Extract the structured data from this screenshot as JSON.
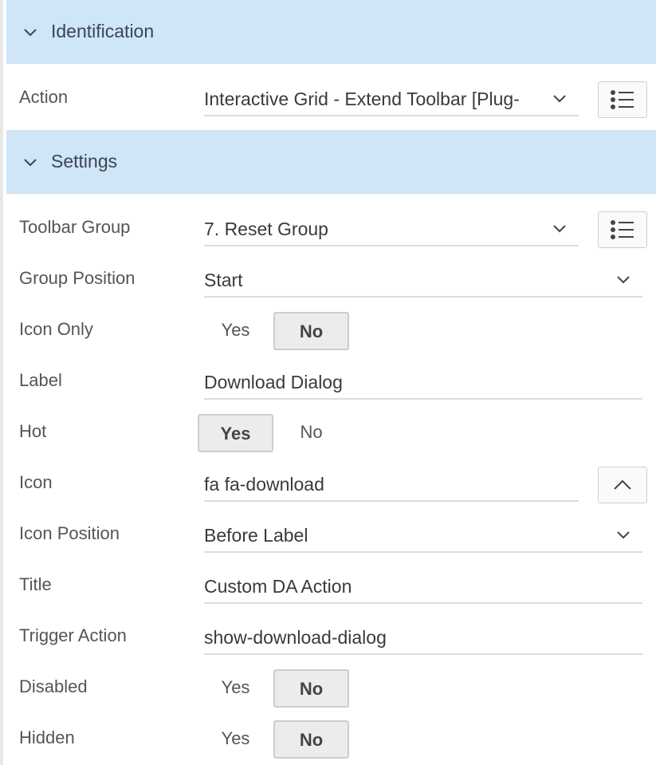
{
  "sections": {
    "identification": {
      "title": "Identification"
    },
    "settings": {
      "title": "Settings"
    }
  },
  "fields": {
    "action": {
      "label": "Action",
      "value": "Interactive Grid - Extend Toolbar [Plug-"
    },
    "toolbar_group": {
      "label": "Toolbar Group",
      "value": "7. Reset Group"
    },
    "group_position": {
      "label": "Group Position",
      "value": "Start"
    },
    "icon_only": {
      "label": "Icon Only",
      "yes": "Yes",
      "no": "No",
      "selected": "No"
    },
    "label": {
      "label": "Label",
      "value": "Download Dialog"
    },
    "hot": {
      "label": "Hot",
      "yes": "Yes",
      "no": "No",
      "selected": "Yes"
    },
    "icon": {
      "label": "Icon",
      "value": "fa fa-download"
    },
    "icon_position": {
      "label": "Icon Position",
      "value": "Before Label"
    },
    "title": {
      "label": "Title",
      "value": "Custom DA Action"
    },
    "trigger_action": {
      "label": "Trigger Action",
      "value": "show-download-dialog"
    },
    "disabled": {
      "label": "Disabled",
      "yes": "Yes",
      "no": "No",
      "selected": "No"
    },
    "hidden": {
      "label": "Hidden",
      "yes": "Yes",
      "no": "No",
      "selected": "No"
    }
  },
  "icons": {
    "section_toggle": "chevron-down-icon",
    "list_button": "list-icon",
    "icon_picker_button": "chevron-up-icon",
    "select_arrow": "chevron-down-icon"
  }
}
